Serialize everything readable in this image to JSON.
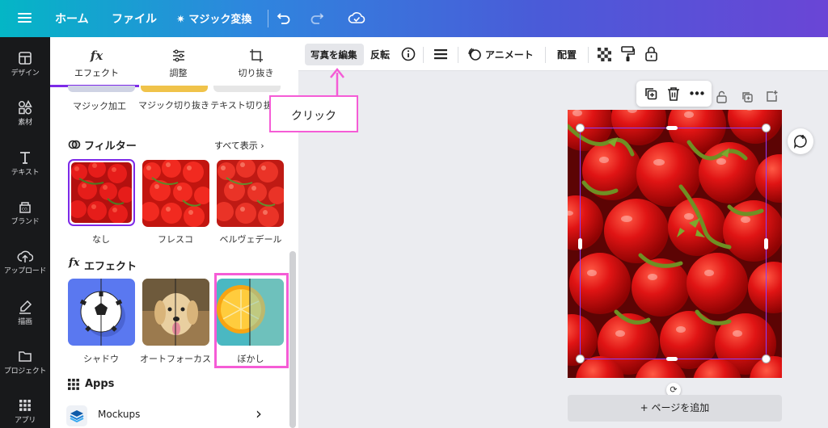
{
  "topbar": {
    "home": "ホーム",
    "file": "ファイル",
    "magic_convert": "マジック変換"
  },
  "leftnav": [
    {
      "label": "デザイン",
      "icon": "layout-icon"
    },
    {
      "label": "素材",
      "icon": "shapes-icon"
    },
    {
      "label": "テキスト",
      "icon": "text-icon"
    },
    {
      "label": "ブランド",
      "icon": "brand-icon"
    },
    {
      "label": "アップロード",
      "icon": "upload-icon"
    },
    {
      "label": "描画",
      "icon": "draw-icon"
    },
    {
      "label": "プロジェクト",
      "icon": "folder-icon"
    },
    {
      "label": "アプリ",
      "icon": "apps-icon"
    }
  ],
  "panel": {
    "tabs": [
      {
        "label": "エフェクト",
        "icon": "fx-icon"
      },
      {
        "label": "調整",
        "icon": "sliders-icon"
      },
      {
        "label": "切り抜き",
        "icon": "crop-icon"
      }
    ],
    "top_row": [
      "マジック加工",
      "マジック切り抜き",
      "テキスト切り抜き"
    ],
    "filters": {
      "title": "フィルター",
      "see_all": "すべて表示",
      "items": [
        "なし",
        "フレスコ",
        "ベルヴェデール"
      ]
    },
    "effects": {
      "title": "エフェクト",
      "items": [
        "シャドウ",
        "オートフォーカス",
        "ぼかし"
      ]
    },
    "apps": {
      "title": "Apps",
      "items": [
        "Mockups"
      ]
    }
  },
  "toolbar": {
    "edit_photo": "写真を編集",
    "flip": "反転",
    "animate": "アニメート",
    "position": "配置"
  },
  "callout": {
    "text": "クリック"
  },
  "canvas": {
    "add_page": "+ ページを追加"
  },
  "colors": {
    "accent": "#7d2ae8",
    "highlight": "#f55cd6",
    "nav_bg": "#18191b"
  }
}
